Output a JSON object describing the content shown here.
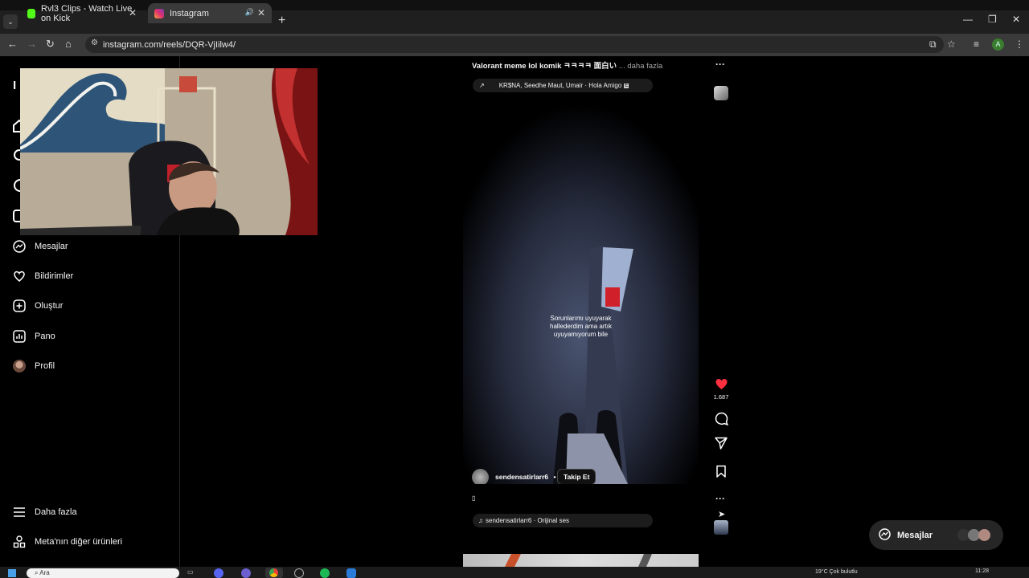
{
  "browser": {
    "tabs": [
      {
        "title": "Rvl3 Clips - Watch Live on Kick",
        "favicon_color": "#53fc18"
      },
      {
        "title": "Instagram",
        "favicon_color": "#e1306c",
        "active": true
      }
    ],
    "url": "instagram.com/reels/DQR-VjIilw4/",
    "profile_initial": "A"
  },
  "sidebar": {
    "items": [
      {
        "label": "Mesajlar",
        "icon": "messenger-icon"
      },
      {
        "label": "Bildirimler",
        "icon": "heart-icon"
      },
      {
        "label": "Oluştur",
        "icon": "plus-square-icon"
      },
      {
        "label": "Pano",
        "icon": "dashboard-icon"
      },
      {
        "label": "Profil",
        "icon": "avatar"
      },
      {
        "label": "Daha fazla",
        "icon": "hamburger-icon"
      },
      {
        "label": "Meta'nın diğer ürünleri",
        "icon": "meta-products-icon"
      }
    ]
  },
  "reel": {
    "caption": "Valorant meme lol komik ㅋㅋㅋㅋ 面白い",
    "caption_more": "... daha fazla",
    "top_music": "KR$NA, Seedhe Maut, Umair · Hola Amigo",
    "overlay_text_1": "Sorunlarımı uyuyarak",
    "overlay_text_2": "hallederdim ama artık",
    "overlay_text_3": "uyuyamıyorum bile",
    "username": "sendensatirlarr6",
    "dot": "•",
    "follow": "Takip Et",
    "description": "▯",
    "audio": "sendensatirlarr6 · Orijinal ses",
    "likes": "1.687",
    "heart_color": "#ff3040"
  },
  "messages_button": {
    "label": "Mesajlar"
  },
  "taskbar": {
    "search_placeholder": "Ara",
    "weather": "19°C  Çok bulutlu",
    "time": "11:28"
  }
}
